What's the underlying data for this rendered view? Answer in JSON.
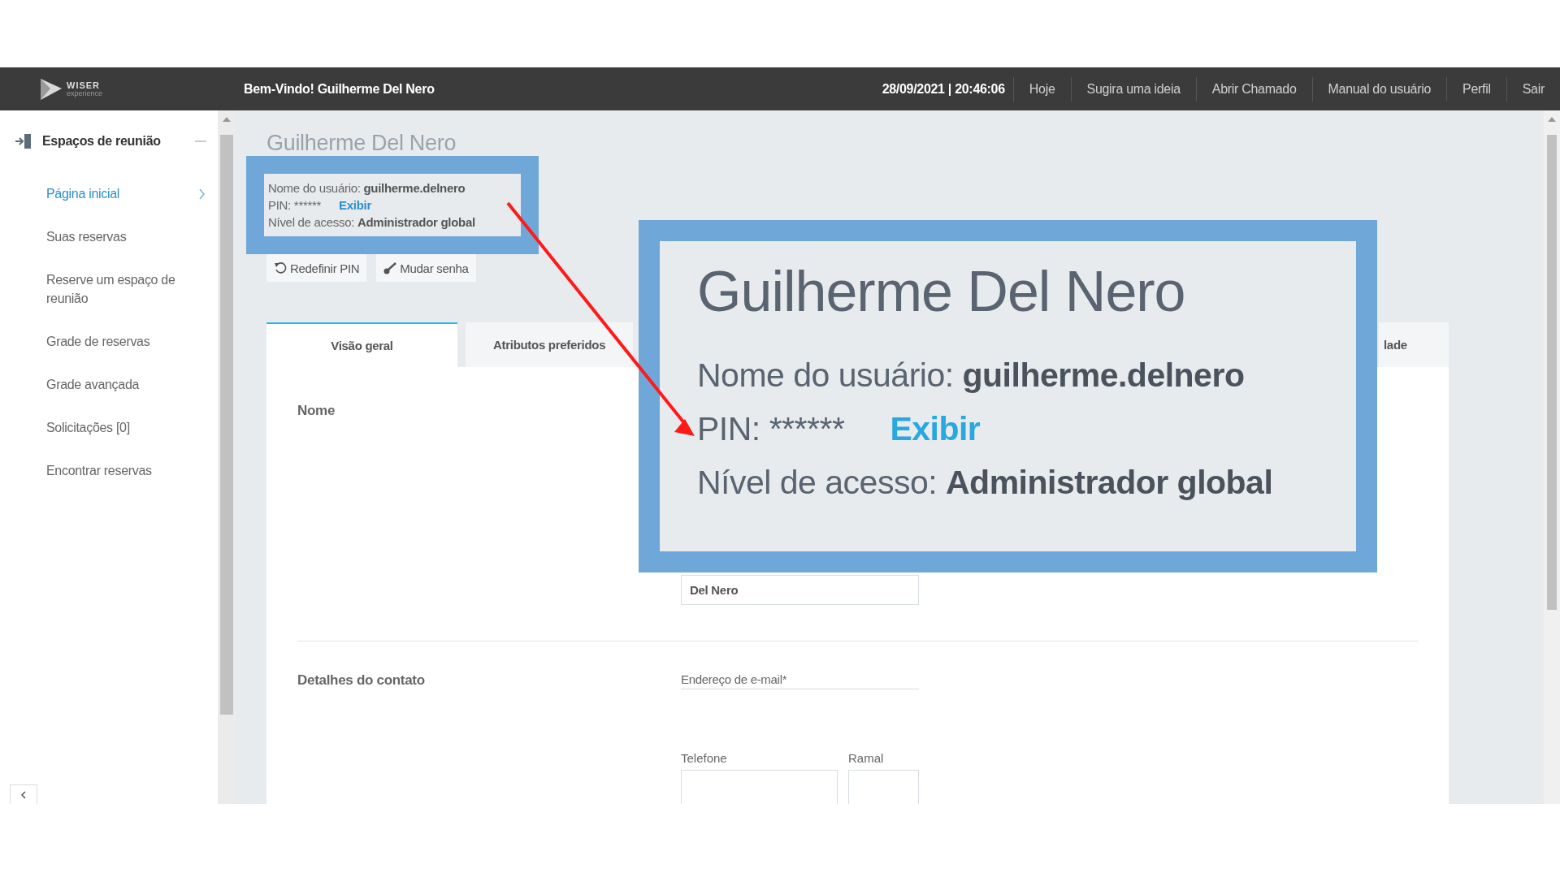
{
  "header": {
    "logo_text": "WISER",
    "logo_subtext": "experience",
    "welcome": "Bem-Vindo! Guilherme Del Nero",
    "datetime": "28/09/2021 | 20:46:06",
    "links": [
      "Hoje",
      "Sugira uma ideia",
      "Abrir Chamado",
      "Manual do usuário",
      "Perfil",
      "Sair"
    ]
  },
  "sidebar": {
    "section": "Espaços de reunião",
    "expanded": true,
    "items": [
      {
        "label": "Página inicial",
        "selected": true
      },
      {
        "label": "Suas reservas",
        "selected": false
      },
      {
        "label": "Reserve um espaço de reunião",
        "selected": false
      },
      {
        "label": "Grade de reservas",
        "selected": false
      },
      {
        "label": "Grade avançada",
        "selected": false
      },
      {
        "label": "Solicitações [0]",
        "selected": false
      },
      {
        "label": "Encontrar reservas",
        "selected": false
      }
    ]
  },
  "profile": {
    "title": "Guilherme Del Nero",
    "username_label": "Nome do usuário:",
    "username": "guilherme.delnero",
    "pin_label": "PIN:",
    "pin": "******",
    "pin_action": "Exibir",
    "access_label": "Nível de acesso:",
    "access": "Administrador global",
    "buttons": [
      {
        "label": "Redefinir PIN",
        "kind": "reset"
      },
      {
        "label": "Mudar senha",
        "kind": "key"
      }
    ]
  },
  "tabs": [
    {
      "label": "Visão geral",
      "selected": true
    },
    {
      "label": "Atributos preferidos",
      "selected": false
    },
    {
      "label": "lade",
      "selected": false
    }
  ],
  "form": {
    "sections": [
      {
        "title": "Nome",
        "fields": [
          {
            "kind": "box",
            "value": "Del Nero"
          }
        ]
      },
      {
        "title": "Detalhes do contato",
        "fields": [
          {
            "kind": "underline",
            "label": "Endereço de e-mail*"
          },
          {
            "kind": "pair",
            "label": "Telefone",
            "label_2": "Ramal"
          }
        ]
      }
    ]
  },
  "callout": {
    "title": "Guilherme Del Nero",
    "username_label": "Nome do usuário:",
    "username": "guilherme.delnero",
    "pin_label": "PIN:",
    "pin": "******",
    "pin_action": "Exibir",
    "access_label": "Nível de acesso:",
    "access": "Administrador global"
  }
}
